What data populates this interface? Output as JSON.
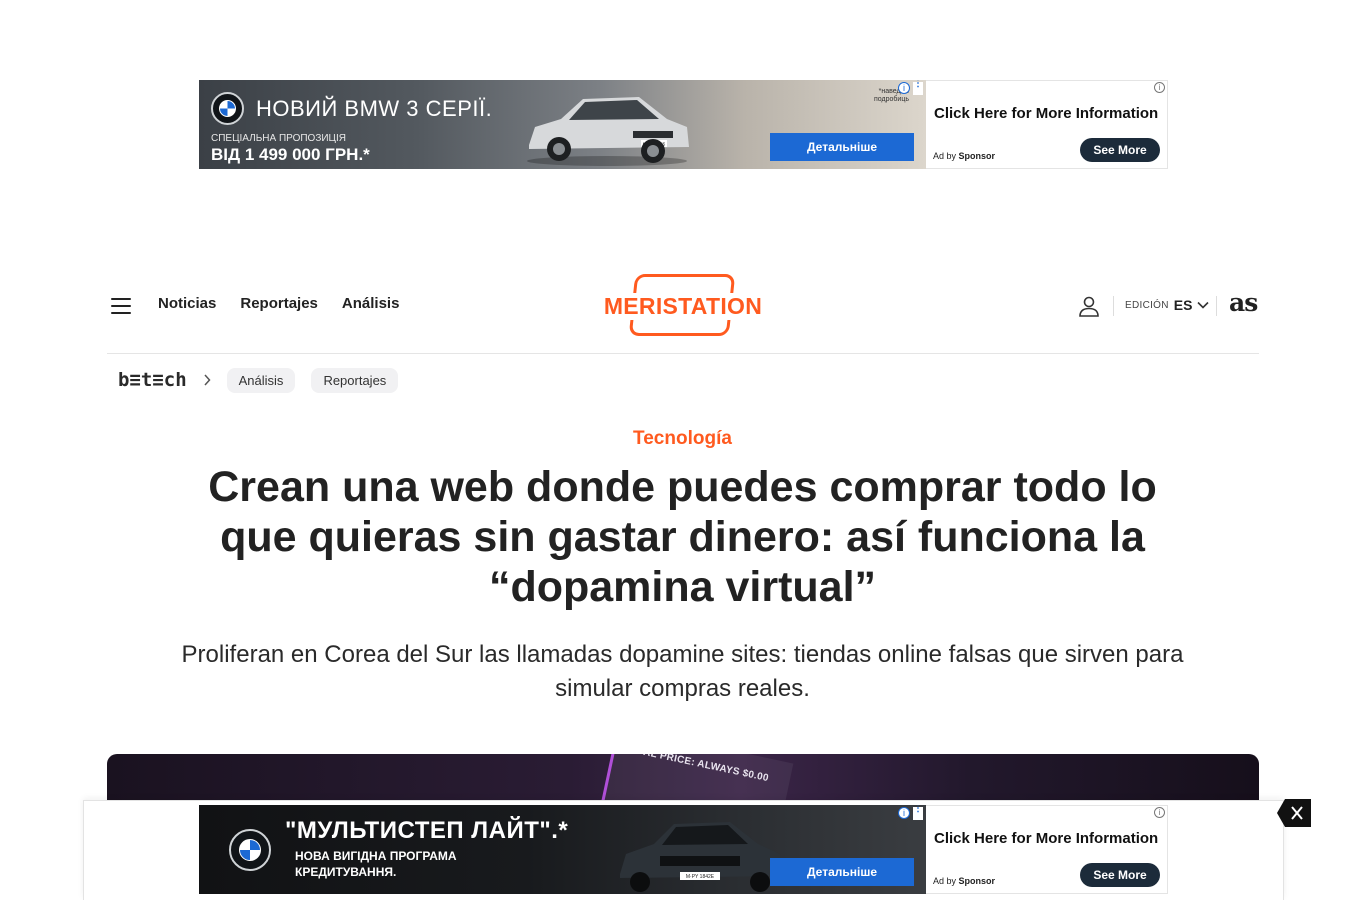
{
  "ads": {
    "top": {
      "headline": "НОВИЙ BMW 3 СЕРІЇ.",
      "sub": "СПЕЦІАЛЬНА ПРОПОЗИЦІЯ",
      "price": "ВІД 1 499 000 ГРН.*",
      "note": "*наведіть\nподробиць",
      "cta": "Детальніше",
      "plate": "M·BE 4385",
      "side_title": "Click Here for More Information",
      "side_adby": "Ad by",
      "side_sponsor": "Sponsor",
      "side_button": "See More"
    },
    "bottom": {
      "headline": "\"МУЛЬТИСТЕП ЛАЙТ\".*",
      "line1": "НОВА ВИГІДНА ПРОГРАМА",
      "line2": "КРЕДИТУВАННЯ.",
      "cta": "Детальніше",
      "plate": "M·PY 1842E",
      "side_title": "Click Here for More Information",
      "side_adby": "Ad by",
      "side_sponsor": "Sponsor",
      "side_button": "See More"
    },
    "info_glyph": "i",
    "dots_glyph": "⋮"
  },
  "header": {
    "nav": [
      "Noticias",
      "Reportajes",
      "Análisis"
    ],
    "logo": "MERISTATION",
    "edition_label": "EDICIÓN",
    "edition_value": "ES",
    "as_logo": "as"
  },
  "breadcrumb": {
    "brand": "b≡t≡ch",
    "pills": [
      "Análisis",
      "Reportajes"
    ]
  },
  "article": {
    "section": "Tecnología",
    "headline": "Crean una web donde puedes comprar todo lo que quieras sin gastar dinero: así funciona la “dopamina virtual”",
    "subhead": "Proliferan en Corea del Sur las llamadas dopamine sites: tiendas online falsas que sirven para simular compras reales.",
    "hero_text": "AL PRICE: ALWAYS $0.00"
  },
  "icons": {
    "menu": "hamburger-menu-icon",
    "user": "user-icon",
    "edition_chevron": "chevron-down-icon",
    "crumb_separator": "chevron-right-icon",
    "close": "close-icon"
  },
  "colors": {
    "brand_orange": "#ff5a1f",
    "bmw_blue": "#1c69d4",
    "text_dark": "#222222"
  }
}
